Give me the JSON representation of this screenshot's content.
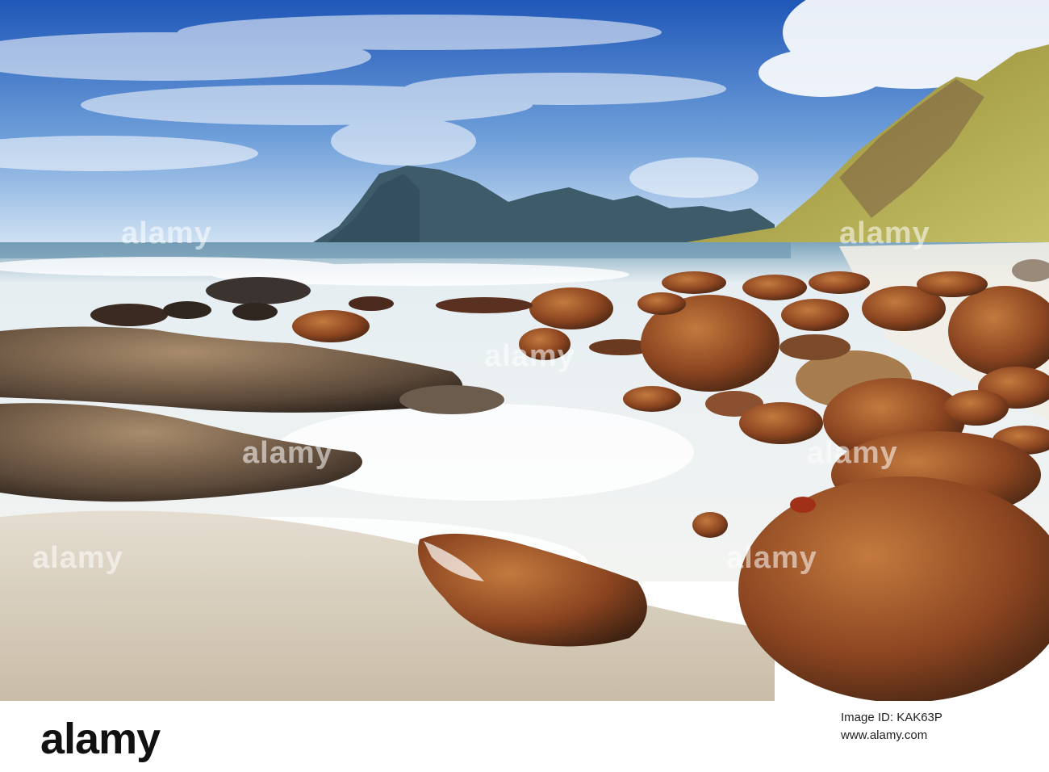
{
  "photo": {
    "watermarks": [
      "alamy",
      "alamy",
      "alamy",
      "alamy",
      "alamy",
      "alamy",
      "alamy"
    ]
  },
  "footer": {
    "logo": "alamy",
    "image_id_label": "Image ID: KAK63P",
    "site": "www.alamy.com"
  },
  "colors": {
    "sky_top": "#2a5fb8",
    "sky_bottom": "#cfe2f4",
    "sea": "#e9eef0",
    "rock": "#8a4a22",
    "sand": "#d9d0c0"
  }
}
